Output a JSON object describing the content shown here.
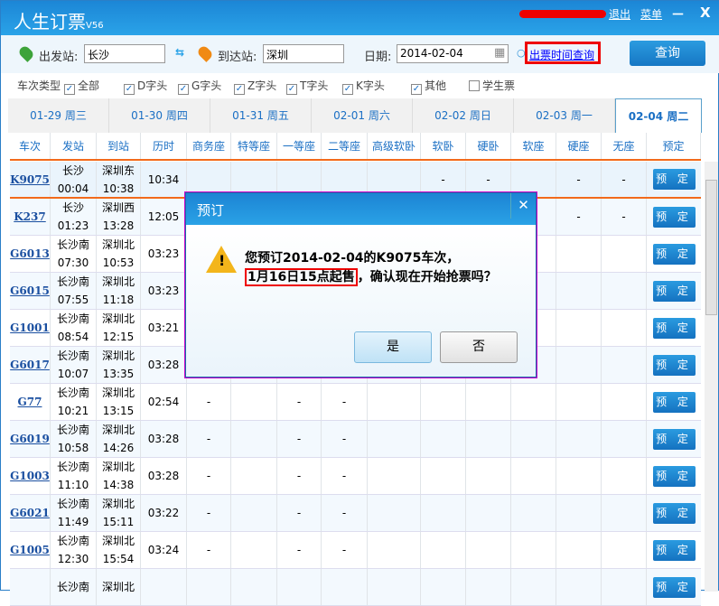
{
  "app": {
    "title": "人生订票",
    "version": "V56",
    "logout": "退出",
    "menu": "菜单",
    "minimize": "－",
    "close": "X"
  },
  "search": {
    "from_label": "出发站:",
    "from_value": "长沙",
    "to_label": "到达站:",
    "to_value": "深圳",
    "date_label": "日期:",
    "date_value": "2014-02-04",
    "sale_time_link": "出票时间查询",
    "query_button": "查询"
  },
  "filters": {
    "label": "车次类型",
    "items": [
      {
        "label": "全部",
        "checked": true
      },
      {
        "label": "D字头",
        "checked": true
      },
      {
        "label": "G字头",
        "checked": true
      },
      {
        "label": "Z字头",
        "checked": true
      },
      {
        "label": "T字头",
        "checked": true
      },
      {
        "label": "K字头",
        "checked": true
      },
      {
        "label": "其他",
        "checked": true
      },
      {
        "label": "学生票",
        "checked": false
      }
    ]
  },
  "date_tabs": [
    "01-29 周三",
    "01-30 周四",
    "01-31 周五",
    "02-01 周六",
    "02-02 周日",
    "02-03 周一",
    "02-04 周二"
  ],
  "active_tab": 6,
  "columns": [
    "车次",
    "发站",
    "到站",
    "历时",
    "商务座",
    "特等座",
    "一等座",
    "二等座",
    "高级软卧",
    "软卧",
    "硬卧",
    "软座",
    "硬座",
    "无座",
    "预定"
  ],
  "book_label": "预 定",
  "rows": [
    {
      "train": "K9075",
      "from": "长沙",
      "dep": "00:04",
      "to": "深圳东",
      "arr": "10:38",
      "dur": "10:34",
      "seats": [
        "",
        "",
        "",
        "",
        "",
        "-",
        "-",
        "",
        "-",
        "-"
      ]
    },
    {
      "train": "K237",
      "from": "长沙",
      "dep": "01:23",
      "to": "深圳西",
      "arr": "13:28",
      "dur": "12:05",
      "seats": [
        "",
        "",
        "",
        "",
        "",
        "",
        "",
        "",
        "-",
        "-"
      ]
    },
    {
      "train": "G6013",
      "from": "长沙南",
      "dep": "07:30",
      "to": "深圳北",
      "arr": "10:53",
      "dur": "03:23",
      "seats": [
        "",
        "",
        "",
        "",
        "",
        "",
        "",
        "",
        "",
        ""
      ]
    },
    {
      "train": "G6015",
      "from": "长沙南",
      "dep": "07:55",
      "to": "深圳北",
      "arr": "11:18",
      "dur": "03:23",
      "seats": [
        "",
        "",
        "",
        "",
        "",
        "",
        "",
        "",
        "",
        ""
      ]
    },
    {
      "train": "G1001",
      "from": "长沙南",
      "dep": "08:54",
      "to": "深圳北",
      "arr": "12:15",
      "dur": "03:21",
      "seats": [
        "",
        "",
        "",
        "",
        "",
        "",
        "",
        "",
        "",
        ""
      ]
    },
    {
      "train": "G6017",
      "from": "长沙南",
      "dep": "10:07",
      "to": "深圳北",
      "arr": "13:35",
      "dur": "03:28",
      "seats": [
        "",
        "",
        "",
        "",
        "",
        "",
        "",
        "",
        "",
        ""
      ]
    },
    {
      "train": "G77",
      "from": "长沙南",
      "dep": "10:21",
      "to": "深圳北",
      "arr": "13:15",
      "dur": "02:54",
      "seats": [
        "-",
        "",
        "-",
        "-",
        "",
        "",
        "",
        "",
        "",
        ""
      ]
    },
    {
      "train": "G6019",
      "from": "长沙南",
      "dep": "10:58",
      "to": "深圳北",
      "arr": "14:26",
      "dur": "03:28",
      "seats": [
        "-",
        "",
        "-",
        "-",
        "",
        "",
        "",
        "",
        "",
        ""
      ]
    },
    {
      "train": "G1003",
      "from": "长沙南",
      "dep": "11:10",
      "to": "深圳北",
      "arr": "14:38",
      "dur": "03:28",
      "seats": [
        "-",
        "",
        "-",
        "-",
        "",
        "",
        "",
        "",
        "",
        ""
      ]
    },
    {
      "train": "G6021",
      "from": "长沙南",
      "dep": "11:49",
      "to": "深圳北",
      "arr": "15:11",
      "dur": "03:22",
      "seats": [
        "-",
        "",
        "-",
        "-",
        "",
        "",
        "",
        "",
        "",
        ""
      ]
    },
    {
      "train": "G1005",
      "from": "长沙南",
      "dep": "12:30",
      "to": "深圳北",
      "arr": "15:54",
      "dur": "03:24",
      "seats": [
        "-",
        "",
        "-",
        "-",
        "",
        "",
        "",
        "",
        "",
        ""
      ]
    },
    {
      "train": "",
      "from": "长沙南",
      "dep": "",
      "to": "深圳北",
      "arr": "",
      "dur": "",
      "seats": [
        "",
        "",
        "",
        "",
        "",
        "",
        "",
        "",
        "",
        ""
      ]
    }
  ],
  "dialog": {
    "title": "预订",
    "line1": "您预订2014-02-04的K9075车次，",
    "highlight": "1月16日15点起售",
    "line2_rest": "，确认现在开始抢票吗？",
    "yes": "是",
    "no": "否"
  }
}
